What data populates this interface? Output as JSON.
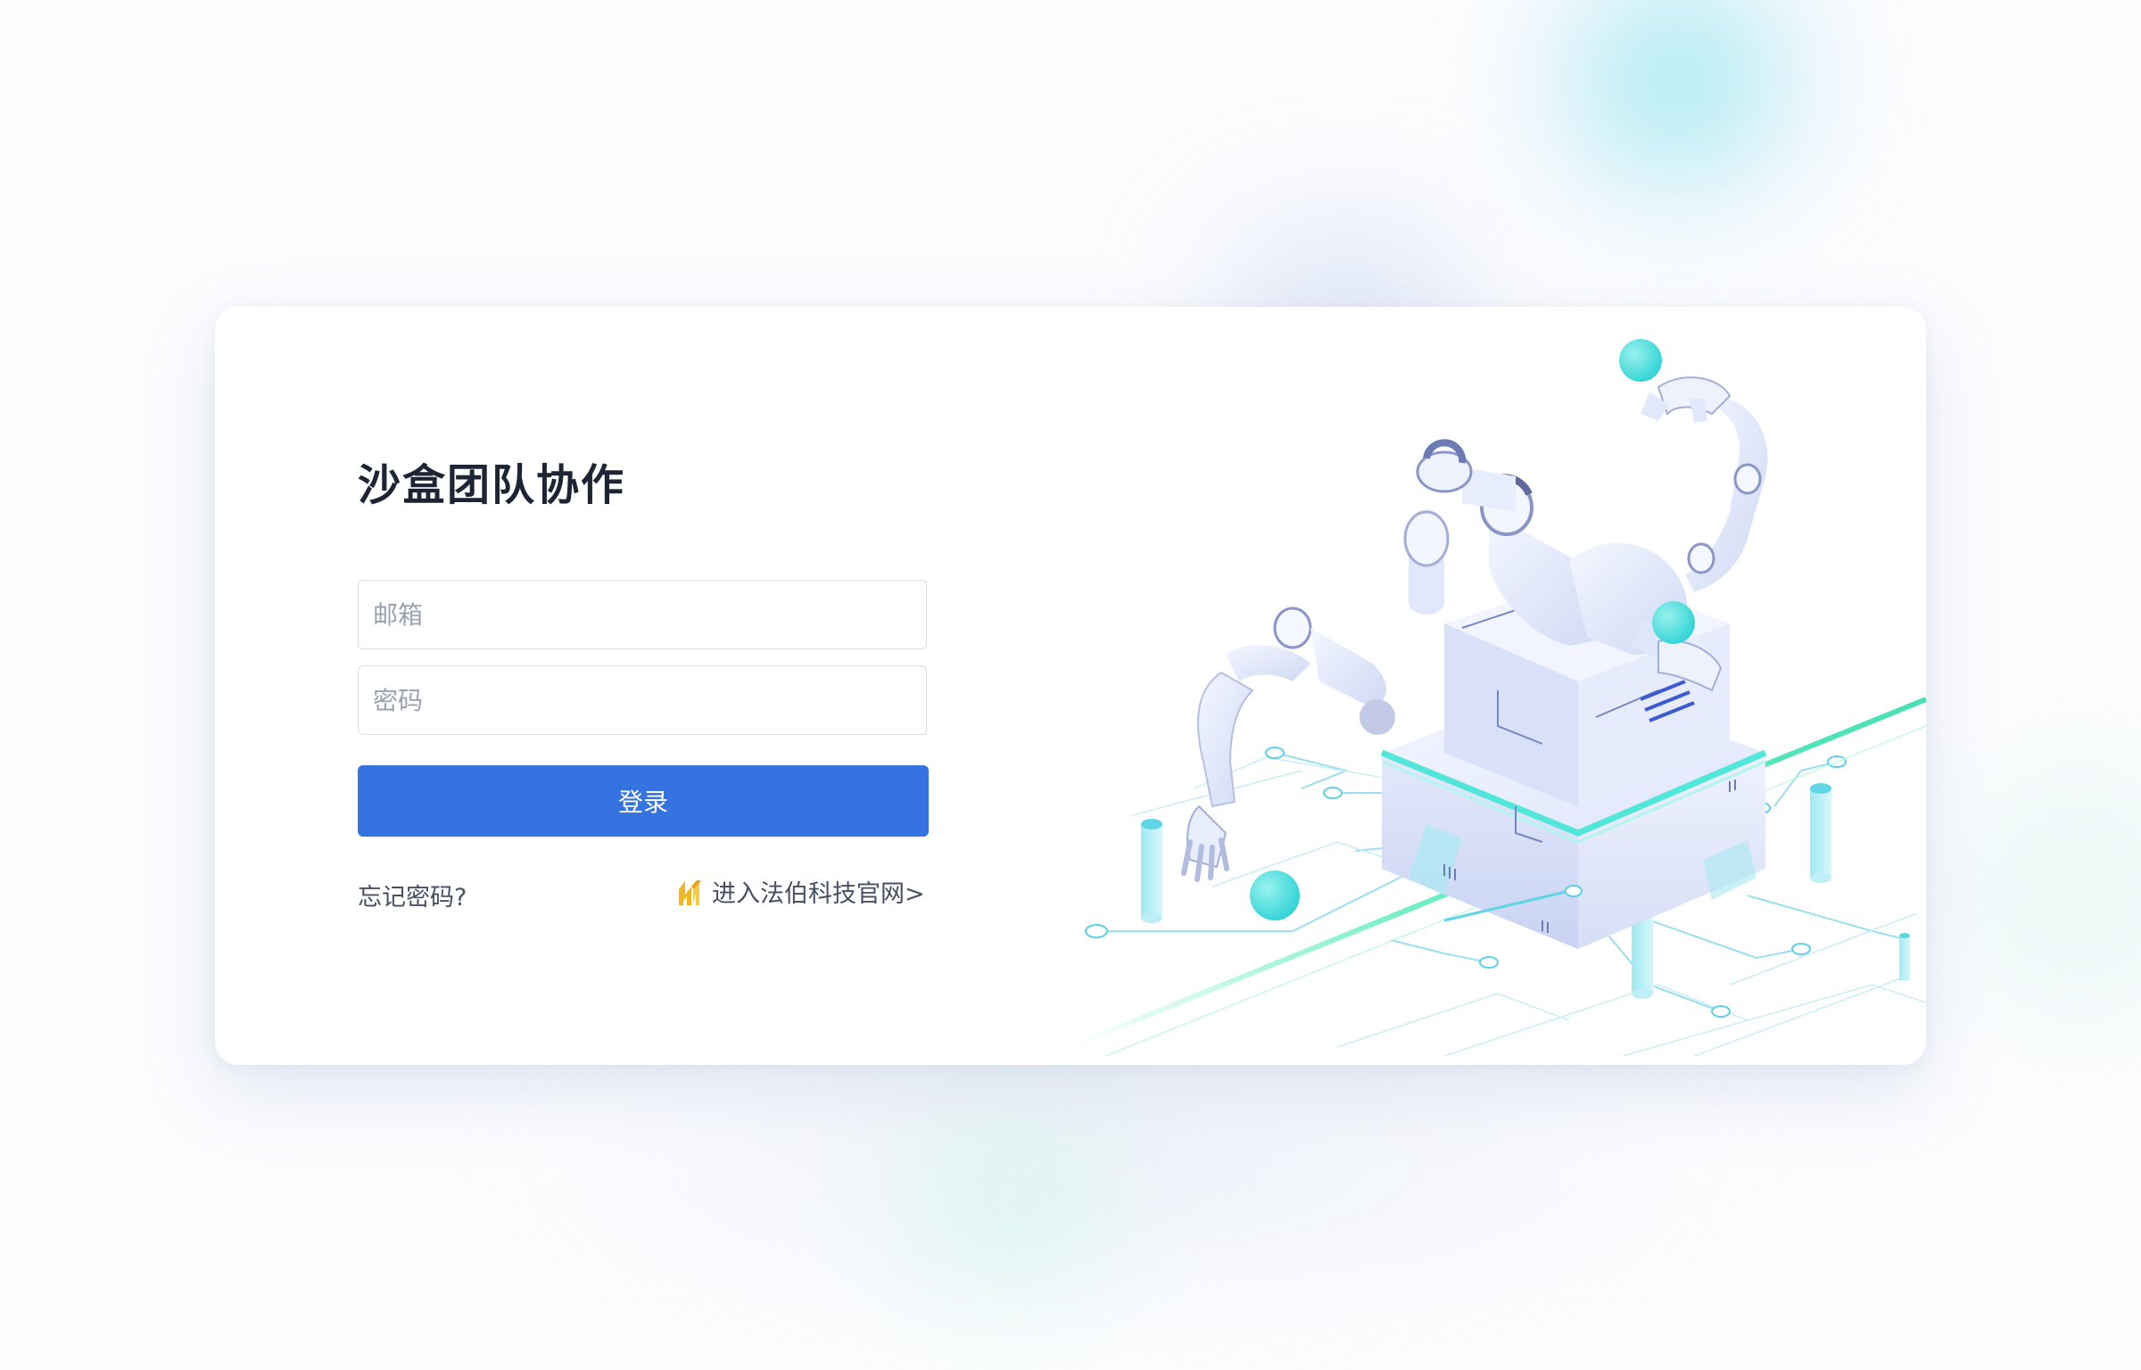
{
  "login": {
    "title": "沙盒团队协作",
    "email_placeholder": "邮箱",
    "password_placeholder": "密码",
    "login_button": "登录",
    "forgot_password": "忘记密码?",
    "official_site": "进入法伯科技官网>"
  },
  "icons": {
    "official_site_logo": "fabo-logo-icon",
    "illustration": "robot-arms-illustration"
  },
  "colors": {
    "primary": "#3574e0",
    "title": "#1d2433",
    "link_text": "#475063",
    "logo": "#f2b620",
    "accent_teal": "#4fdfe0",
    "accent_green": "#5ef0b0"
  }
}
